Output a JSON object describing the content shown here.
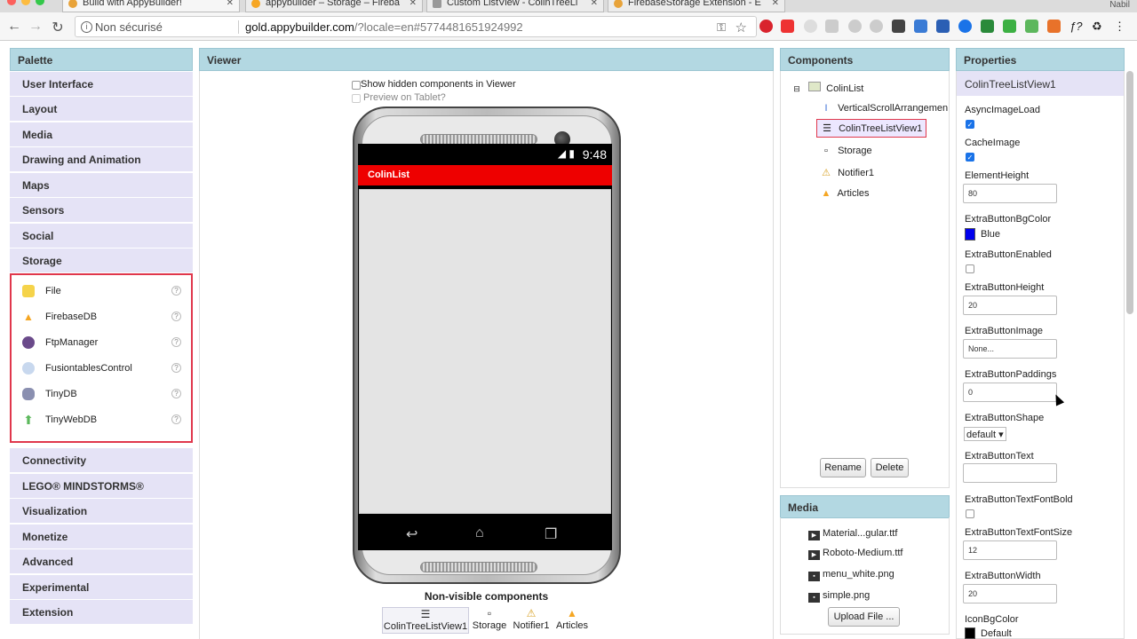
{
  "browser": {
    "tabs": [
      {
        "title": "Build with AppyBuilder!",
        "active": true
      },
      {
        "title": "appybuilder – Storage – Fireba",
        "active": false
      },
      {
        "title": "Custom ListView - ColinTreeLi",
        "active": false
      },
      {
        "title": "FirebaseStorage Extension - E",
        "active": false
      }
    ],
    "user": "Nabil",
    "security_label": "Non sécurisé",
    "url_host": "gold.appybuilder.com",
    "url_path": "/?locale=en#5774481651924992"
  },
  "palette": {
    "title": "Palette",
    "categories_top": [
      "User Interface",
      "Layout",
      "Media",
      "Drawing and Animation",
      "Maps",
      "Sensors",
      "Social",
      "Storage"
    ],
    "storage_items": [
      {
        "label": "File",
        "icon": "folder-icon"
      },
      {
        "label": "FirebaseDB",
        "icon": "firebase-icon"
      },
      {
        "label": "FtpManager",
        "icon": "ftp-icon"
      },
      {
        "label": "FusiontablesControl",
        "icon": "fusiontables-icon"
      },
      {
        "label": "TinyDB",
        "icon": "database-icon"
      },
      {
        "label": "TinyWebDB",
        "icon": "upload-arrow-icon"
      }
    ],
    "help_glyph": "?",
    "categories_bottom": [
      "Connectivity",
      "LEGO® MINDSTORMS®",
      "Visualization",
      "Monetize",
      "Advanced",
      "Experimental",
      "Extension"
    ]
  },
  "viewer": {
    "title": "Viewer",
    "show_hidden": "Show hidden components in Viewer",
    "preview_tablet": "Preview on Tablet?",
    "status_time": "9:48",
    "app_title": "ColinList",
    "nonvisible_title": "Non-visible components",
    "nonvisible": [
      {
        "label": "ColinTreeListView1",
        "icon": "list-icon"
      },
      {
        "label": "Storage",
        "icon": "storage-icon"
      },
      {
        "label": "Notifier1",
        "icon": "warning-icon"
      },
      {
        "label": "Articles",
        "icon": "firebase-icon"
      }
    ]
  },
  "components": {
    "title": "Components",
    "root": "ColinList",
    "children": [
      "VerticalScrollArrangemen",
      "ColinTreeListView1",
      "Storage",
      "Notifier1",
      "Articles"
    ],
    "selected": "ColinTreeListView1",
    "rename": "Rename",
    "delete": "Delete"
  },
  "media": {
    "title": "Media",
    "files": [
      "Material...gular.ttf",
      "Roboto-Medium.ttf",
      "menu_white.png",
      "simple.png"
    ],
    "upload": "Upload File ..."
  },
  "properties": {
    "title": "Properties",
    "component": "ColinTreeListView1",
    "items": {
      "async_image_load": {
        "label": "AsyncImageLoad",
        "checked": true
      },
      "cache_image": {
        "label": "CacheImage",
        "checked": true
      },
      "element_height": {
        "label": "ElementHeight",
        "value": "80"
      },
      "extra_button_bg_color": {
        "label": "ExtraButtonBgColor",
        "value": "Blue",
        "color": "#0000ee"
      },
      "extra_button_enabled": {
        "label": "ExtraButtonEnabled",
        "checked": false
      },
      "extra_button_height": {
        "label": "ExtraButtonHeight",
        "value": "20"
      },
      "extra_button_image": {
        "label": "ExtraButtonImage",
        "value": "None..."
      },
      "extra_button_paddings": {
        "label": "ExtraButtonPaddings",
        "value": "0"
      },
      "extra_button_shape": {
        "label": "ExtraButtonShape",
        "value": "default ▾"
      },
      "extra_button_text": {
        "label": "ExtraButtonText",
        "value": ""
      },
      "extra_button_text_font_bold": {
        "label": "ExtraButtonTextFontBold",
        "checked": false
      },
      "extra_button_text_font_size": {
        "label": "ExtraButtonTextFontSize",
        "value": "12"
      },
      "extra_button_width": {
        "label": "ExtraButtonWidth",
        "value": "20"
      },
      "icon_bg_color": {
        "label": "IconBgColor",
        "value": "Default",
        "color": "#000000"
      }
    }
  },
  "colors": {
    "panel_header": "#b3d8e2",
    "palette_item": "#e5e3f6",
    "highlight_border": "#e0374c",
    "app_titlebar": "#ee0000"
  }
}
